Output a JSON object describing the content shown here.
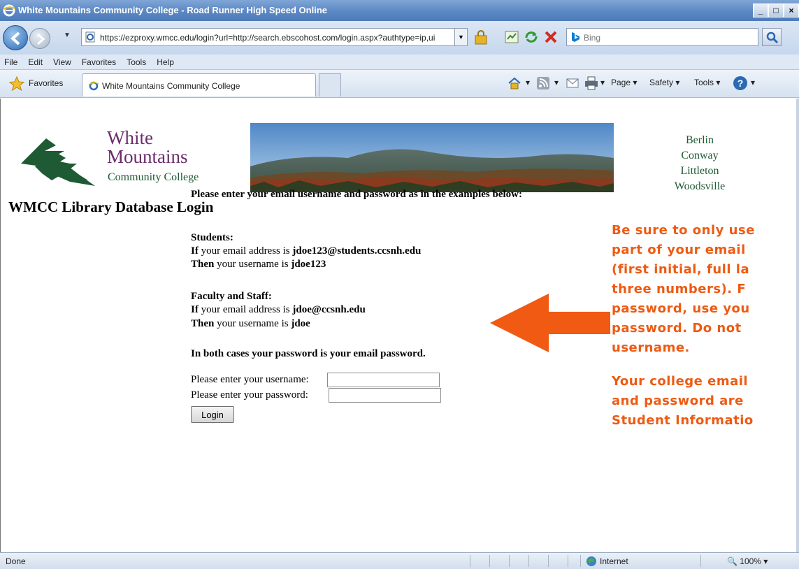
{
  "window": {
    "title": "White Mountains Community College - Road Runner High Speed Online",
    "min_label": "_",
    "max_label": "□",
    "close_label": "×"
  },
  "navbar": {
    "url": "https://ezproxy.wmcc.edu/login?url=http://search.ebscohost.com/login.aspx?authtype=ip,ui",
    "search_placeholder": "Bing"
  },
  "menu": [
    "File",
    "Edit",
    "View",
    "Favorites",
    "Tools",
    "Help"
  ],
  "favbar": {
    "favorites_label": "Favorites",
    "tab_title": "White Mountains Community College",
    "page_label": "Page ▾",
    "safety_label": "Safety ▾",
    "tools_label": "Tools ▾"
  },
  "logo": {
    "line1": "White",
    "line2": "Mountains",
    "line3": "Community College"
  },
  "campuses": [
    "Berlin",
    "Conway",
    "Littleton",
    "Woodsville"
  ],
  "page_title": "WMCC Library Database Login",
  "instructions": {
    "intro": "Please enter your email username and password as in the examples below:",
    "students_heading": "Students:",
    "if_label": "If",
    "then_label": "Then",
    "students_if_text": " your email address is ",
    "students_email": "jdoe123@students.ccsnh.edu",
    "students_then_text": " your username is ",
    "students_username": "jdoe123",
    "faculty_heading": "Faculty and Staff:",
    "faculty_if_text": " your email address is ",
    "faculty_email": "jdoe@ccsnh.edu",
    "faculty_then_text": " your username is ",
    "faculty_username": "jdoe",
    "both_cases": "In both cases your password is your email password."
  },
  "form": {
    "username_label": "Please enter your username:",
    "password_label": "Please enter your password:",
    "username_value": "",
    "password_value": "",
    "login_label": "Login"
  },
  "callout": {
    "lines": [
      "Be sure to only use",
      "part of your email",
      "(first initial, full la",
      "three numbers).  F",
      "password, use you",
      "password.  Do not",
      "username.",
      "",
      "Your college email",
      "and password are",
      "Student Informatio"
    ],
    "color": "#ee5a12"
  },
  "statusbar": {
    "status": "Done",
    "zone": "Internet",
    "zoom": "100%"
  }
}
